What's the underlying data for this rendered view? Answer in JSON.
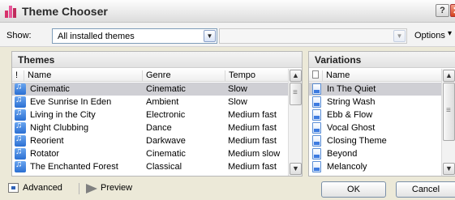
{
  "window": {
    "title": "Theme Chooser",
    "help_label": "?",
    "close_label": "✕",
    "icon_colors": [
      "#d6316b",
      "#e8579a",
      "#c02b5c"
    ]
  },
  "toolbar": {
    "show_label": "Show:",
    "show_selected": "All installed themes",
    "options_label": "Options",
    "dropdown_glyph": "▼"
  },
  "themes": {
    "header": "Themes",
    "columns": [
      "!",
      "Name",
      "Genre",
      "Tempo"
    ],
    "rows": [
      {
        "name": "Cinematic",
        "genre": "Cinematic",
        "tempo": "Slow",
        "selected": true
      },
      {
        "name": "Eve Sunrise In Eden",
        "genre": "Ambient",
        "tempo": "Slow"
      },
      {
        "name": "Living in the City",
        "genre": "Electronic",
        "tempo": "Medium fast"
      },
      {
        "name": "Night Clubbing",
        "genre": "Dance",
        "tempo": "Medium fast"
      },
      {
        "name": "Reorient",
        "genre": "Darkwave",
        "tempo": "Medium fast"
      },
      {
        "name": "Rotator",
        "genre": "Cinematic",
        "tempo": "Medium slow"
      },
      {
        "name": "The Enchanted Forest",
        "genre": "Classical",
        "tempo": "Medium fast"
      }
    ]
  },
  "variations": {
    "header": "Variations",
    "column_name": "Name",
    "rows": [
      {
        "name": "In The Quiet",
        "selected": true
      },
      {
        "name": "String Wash"
      },
      {
        "name": "Ebb & Flow"
      },
      {
        "name": "Vocal Ghost"
      },
      {
        "name": "Closing Theme"
      },
      {
        "name": "Beyond"
      },
      {
        "name": "Melancoly"
      }
    ]
  },
  "footer": {
    "advanced_label": "Advanced",
    "preview_label": "Preview",
    "ok_label": "OK",
    "cancel_label": "Cancel"
  }
}
